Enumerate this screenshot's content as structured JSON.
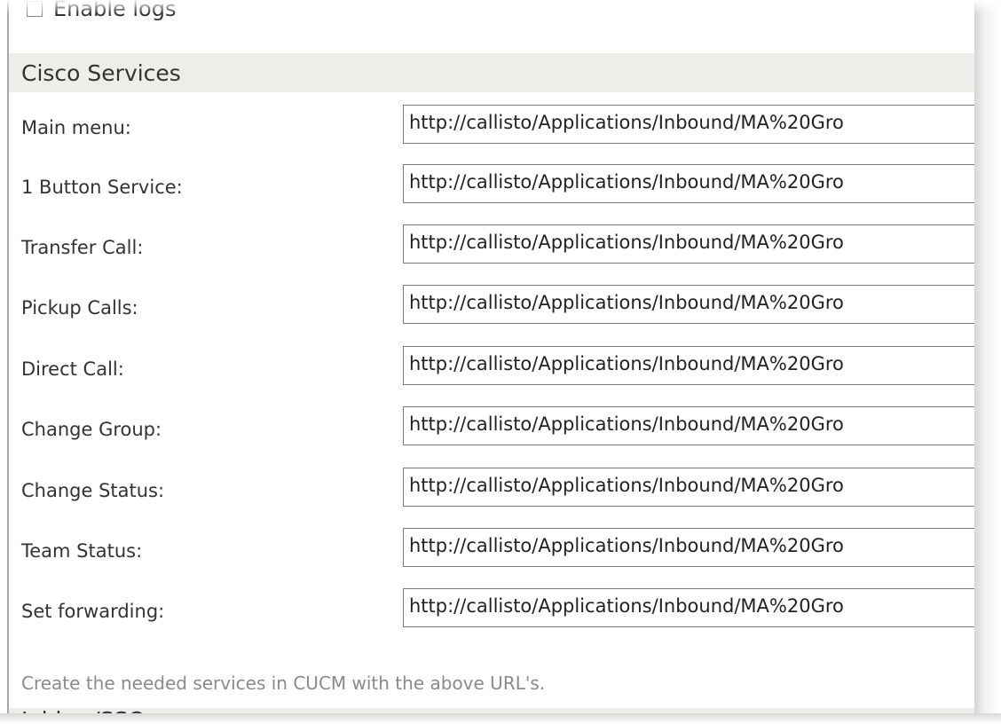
{
  "enable_logs": {
    "label": "Enable logs",
    "checked": false
  },
  "section": {
    "title": "Cisco Services"
  },
  "services": [
    {
      "label": "Main menu:",
      "value": "http://callisto/Applications/Inbound/MA%20Gro"
    },
    {
      "label": "1 Button Service:",
      "value": "http://callisto/Applications/Inbound/MA%20Gro"
    },
    {
      "label": "Transfer Call:",
      "value": "http://callisto/Applications/Inbound/MA%20Gro"
    },
    {
      "label": "Pickup Calls:",
      "value": "http://callisto/Applications/Inbound/MA%20Gro"
    },
    {
      "label": "Direct Call:",
      "value": "http://callisto/Applications/Inbound/MA%20Gro"
    },
    {
      "label": "Change Group:",
      "value": "http://callisto/Applications/Inbound/MA%20Gro"
    },
    {
      "label": "Change Status:",
      "value": "http://callisto/Applications/Inbound/MA%20Gro"
    },
    {
      "label": "Team Status:",
      "value": "http://callisto/Applications/Inbound/MA%20Gro"
    },
    {
      "label": "Set forwarding:",
      "value": "http://callisto/Applications/Inbound/MA%20Gro"
    }
  ],
  "note": "Create the needed services in CUCM with the above URL's.",
  "next_section": {
    "title": "Jabber/SSO"
  },
  "colors": {
    "header_bg": "#ededea",
    "text": "#333333",
    "note_text": "#8a8a8a",
    "input_border": "#7a7a7a"
  }
}
